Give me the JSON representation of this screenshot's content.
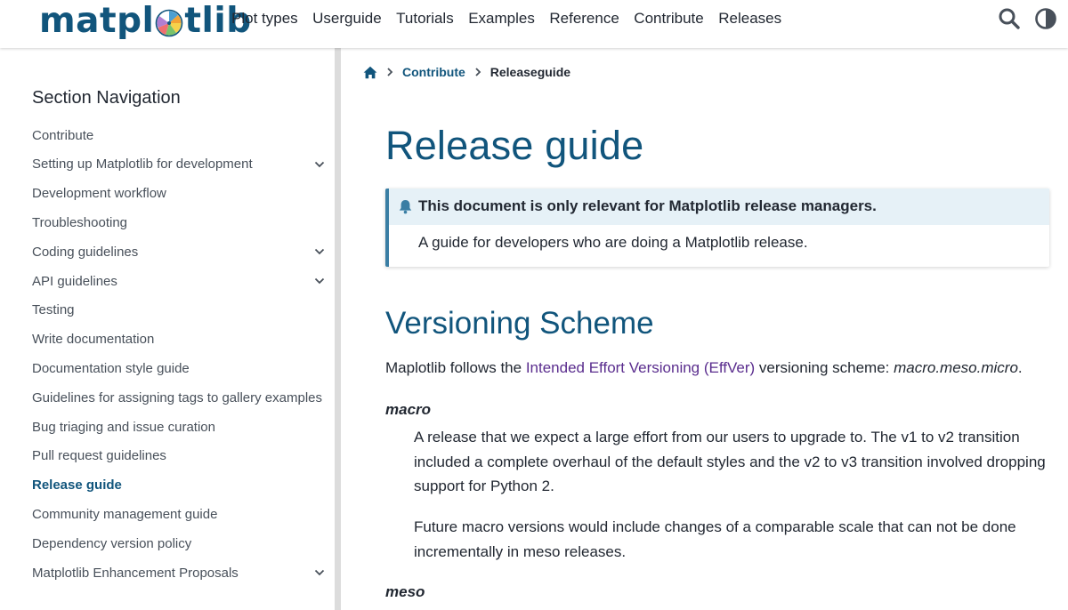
{
  "header": {
    "logo_text_left": "matpl",
    "logo_text_right": "tlib",
    "nav": [
      "Plot types",
      "Userguide",
      "Tutorials",
      "Examples",
      "Reference",
      "Contribute",
      "Releases"
    ]
  },
  "icons": {
    "search": "search-icon",
    "theme": "theme-toggle-icon",
    "home": "home-icon",
    "chevron_right": "chevron-right-icon",
    "chevron_down": "chevron-down-icon",
    "bell": "bell-icon"
  },
  "sidebar": {
    "title": "Section Navigation",
    "items": [
      {
        "label": "Contribute",
        "expandable": false,
        "active": false
      },
      {
        "label": "Setting up Matplotlib for development",
        "expandable": true,
        "active": false
      },
      {
        "label": "Development workflow",
        "expandable": false,
        "active": false
      },
      {
        "label": "Troubleshooting",
        "expandable": false,
        "active": false
      },
      {
        "label": "Coding guidelines",
        "expandable": true,
        "active": false
      },
      {
        "label": "API guidelines",
        "expandable": true,
        "active": false
      },
      {
        "label": "Testing",
        "expandable": false,
        "active": false
      },
      {
        "label": "Write documentation",
        "expandable": false,
        "active": false
      },
      {
        "label": "Documentation style guide",
        "expandable": false,
        "active": false
      },
      {
        "label": "Guidelines for assigning tags to gallery examples",
        "expandable": false,
        "active": false
      },
      {
        "label": "Bug triaging and issue curation",
        "expandable": false,
        "active": false
      },
      {
        "label": "Pull request guidelines",
        "expandable": false,
        "active": false
      },
      {
        "label": "Release guide",
        "expandable": false,
        "active": true
      },
      {
        "label": "Community management guide",
        "expandable": false,
        "active": false
      },
      {
        "label": "Dependency version policy",
        "expandable": false,
        "active": false
      },
      {
        "label": "Matplotlib Enhancement Proposals",
        "expandable": true,
        "active": false
      }
    ]
  },
  "breadcrumb": {
    "parent": "Contribute",
    "current": "Releaseguide"
  },
  "main": {
    "title": "Release guide",
    "admonition": {
      "title": "This document is only relevant for Matplotlib release managers.",
      "body": "A guide for developers who are doing a Matplotlib release."
    },
    "section_title": "Versioning Scheme",
    "intro_before": "Maplotlib follows the ",
    "intro_link": "Intended Effort Versioning (EffVer)",
    "intro_after": " versioning scheme: ",
    "intro_scheme": "macro.meso.micro",
    "intro_end": ".",
    "macro_term": "macro",
    "macro_p1": "A release that we expect a large effort from our users to upgrade to. The v1 to v2 transition included a complete overhaul of the default styles and the v2 to v3 transition involved dropping support for Python 2.",
    "macro_p2": "Future macro versions would include changes of a comparable scale that can not be done incrementally in meso releases.",
    "meso_term": "meso"
  },
  "colors": {
    "brand": "#11557c",
    "link_visited": "#5a2d8e",
    "admonition_accent": "#3a7ea4",
    "admonition_header_bg": "#e6f1f7"
  }
}
